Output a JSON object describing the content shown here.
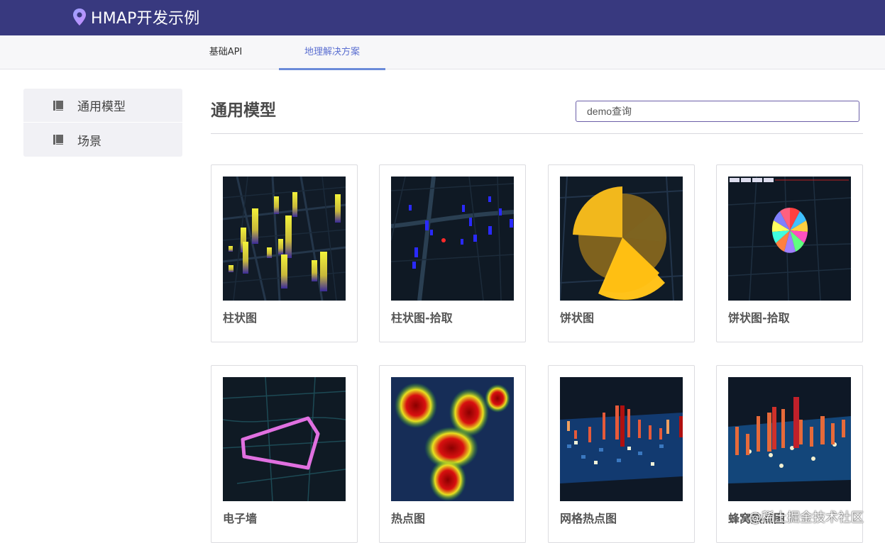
{
  "header": {
    "title": "HMAP开发示例",
    "logo_icon": "map-pin-icon",
    "bg_color": "#38397f"
  },
  "tabs": [
    {
      "label": "基础API",
      "active": false
    },
    {
      "label": "地理解决方案",
      "active": true
    }
  ],
  "sidebar": {
    "items": [
      {
        "label": "通用模型",
        "icon": "book-icon"
      },
      {
        "label": "场景",
        "icon": "book-icon"
      }
    ]
  },
  "main": {
    "title": "通用模型",
    "search": {
      "placeholder": "demo查询",
      "value": ""
    },
    "cards": [
      {
        "label": "柱状图"
      },
      {
        "label": "柱状图-拾取"
      },
      {
        "label": "饼状图"
      },
      {
        "label": "饼状图-拾取"
      },
      {
        "label": "电子墙"
      },
      {
        "label": "热点图"
      },
      {
        "label": "网格热点图"
      },
      {
        "label": "蜂窝热点图"
      }
    ]
  },
  "watermark": "@稀土掘金技术社区"
}
